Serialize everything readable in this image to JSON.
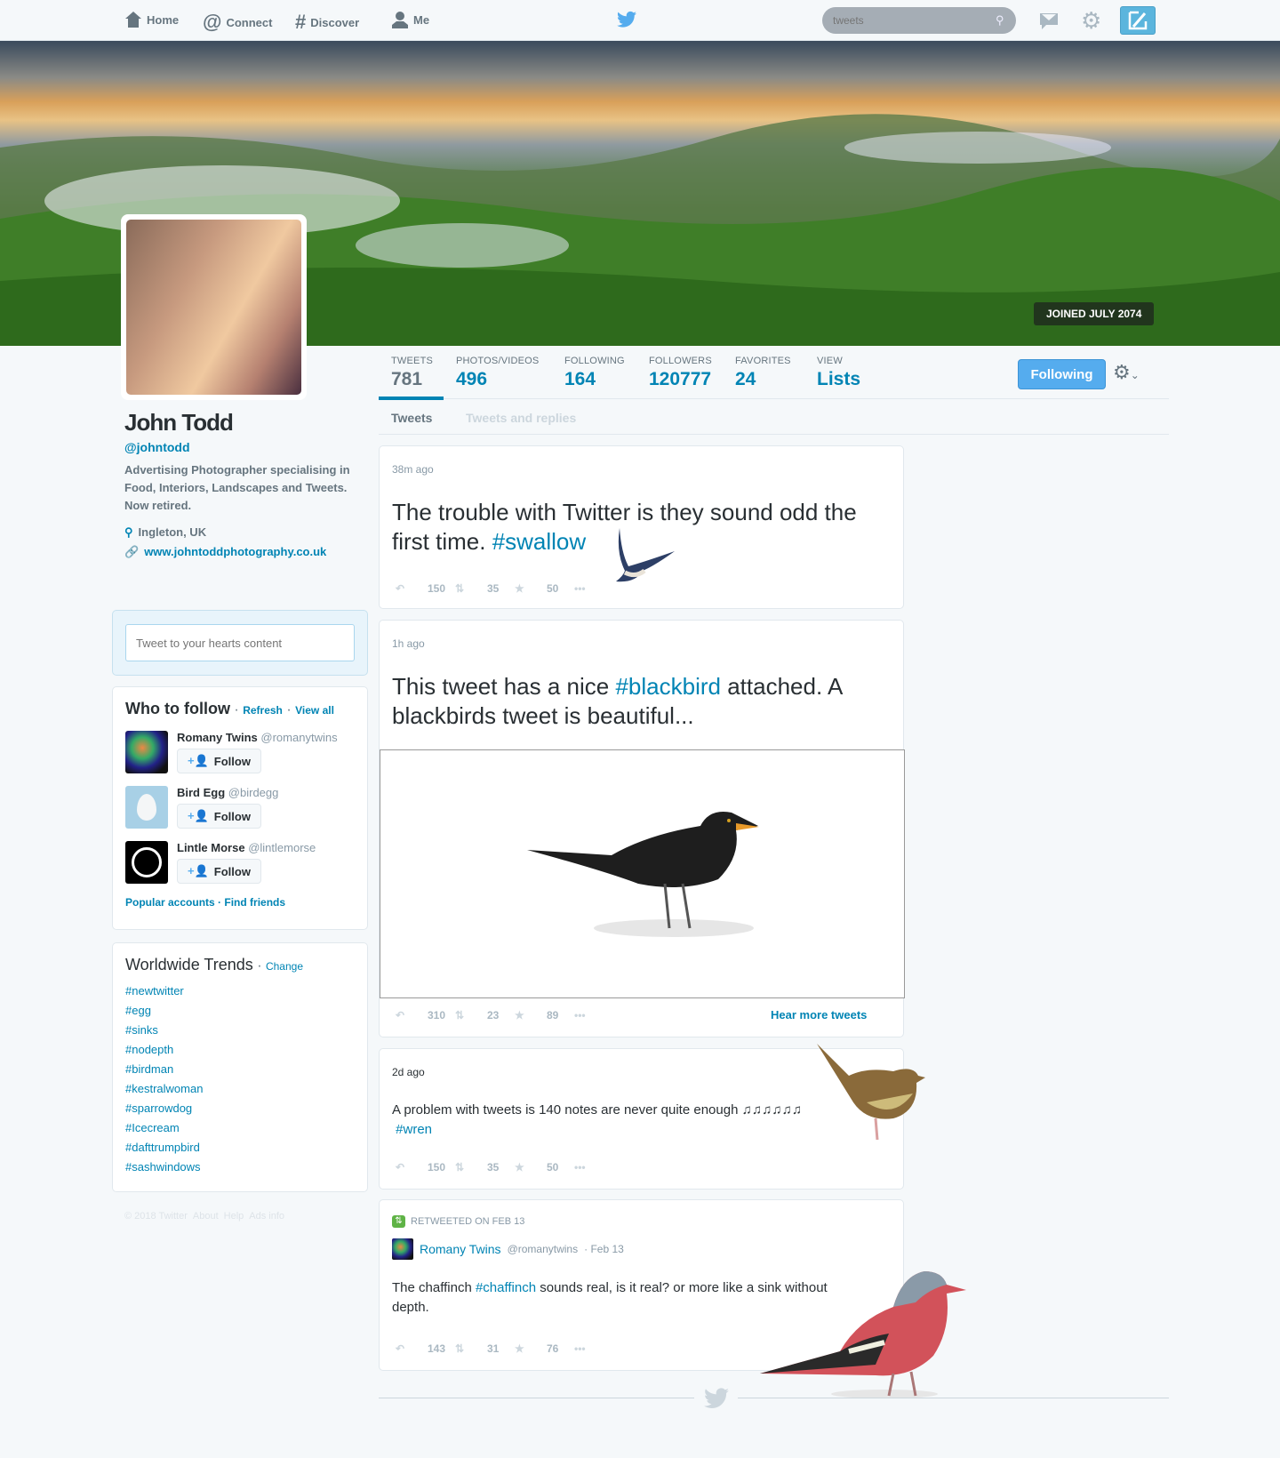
{
  "nav": {
    "items": [
      {
        "label": "Home",
        "icon": "home-icon"
      },
      {
        "label": "Connect",
        "icon": "at-icon"
      },
      {
        "label": "Discover",
        "icon": "hash-icon"
      },
      {
        "label": "Me",
        "icon": "user-icon"
      }
    ],
    "search_placeholder": "tweets"
  },
  "profile": {
    "joined": "JOINED JULY 2074",
    "name": "John Todd",
    "handle": "@johntodd",
    "bio": "Advertising Photographer specialising in Food, Interiors, Landscapes and Tweets. Now retired.",
    "location": "Ingleton, UK",
    "url": "www.johntoddphotography.co.uk"
  },
  "stats": [
    {
      "label": "TWEETS",
      "value": "781"
    },
    {
      "label": "PHOTOS/VIDEOS",
      "value": "496"
    },
    {
      "label": "FOLLOWING",
      "value": "164"
    },
    {
      "label": "FOLLOWERS",
      "value": "120777"
    },
    {
      "label": "FAVORITES",
      "value": "24"
    },
    {
      "label": "VIEW",
      "value": "Lists"
    }
  ],
  "following_button": "Following",
  "tabs": [
    "Tweets",
    "Tweets and replies"
  ],
  "tweet_box_placeholder": "Tweet to your hearts content",
  "who_to_follow": {
    "title": "Who to follow",
    "refresh": "Refresh",
    "view_all": "View all",
    "follow_label": "Follow",
    "users": [
      {
        "name": "Romany Twins",
        "handle": "@romanytwins"
      },
      {
        "name": "Bird Egg",
        "handle": "@birdegg"
      },
      {
        "name": "Lintle Morse",
        "handle": "@lintlemorse"
      }
    ],
    "popular": "Popular accounts",
    "find_friends": "Find friends"
  },
  "trends": {
    "title": "Worldwide Trends",
    "change": "Change",
    "items": [
      "#newtwitter",
      "#egg",
      "#sinks",
      "#nodepth",
      "#birdman",
      "#kestralwoman",
      "#sparrowdog",
      "#Icecream",
      "#dafttrumpbird",
      "#sashwindows"
    ]
  },
  "footer": {
    "copyright": "© 2018 Twitter",
    "about": "About",
    "help": "Help",
    "ads": "Ads info"
  },
  "tweets": [
    {
      "time": "38m ago",
      "text": "The trouble with Twitter is they sound odd the first time.",
      "hashtag": "#swallow",
      "replies": "150",
      "retweets": "35",
      "favorites": "50"
    },
    {
      "time": "1h ago",
      "text_a": "This tweet has a nice",
      "hashtag": "#blackbird",
      "text_b": "attached. A blackbirds tweet is beautiful...",
      "replies": "310",
      "retweets": "23",
      "favorites": "89",
      "more": "Hear more tweets"
    },
    {
      "time": "2d ago",
      "text": "A problem with tweets is 140 notes are never quite enough ♫♫♫♫♫♫",
      "hashtag": "#wren",
      "replies": "150",
      "retweets": "35",
      "favorites": "50"
    },
    {
      "retweeted": "RETWEETED ON FEB 13",
      "author": "Romany Twins",
      "handle": "@romanytwins",
      "date": "· Feb 13",
      "text_a": "The chaffinch",
      "hashtag": "#chaffinch",
      "text_b": "sounds real, is it real? or more like a sink without depth.",
      "replies": "143",
      "retweets": "31",
      "favorites": "76"
    }
  ],
  "colors": {
    "accent": "#0084b4",
    "button": "#55acee",
    "bg": "#f5f8fa"
  }
}
